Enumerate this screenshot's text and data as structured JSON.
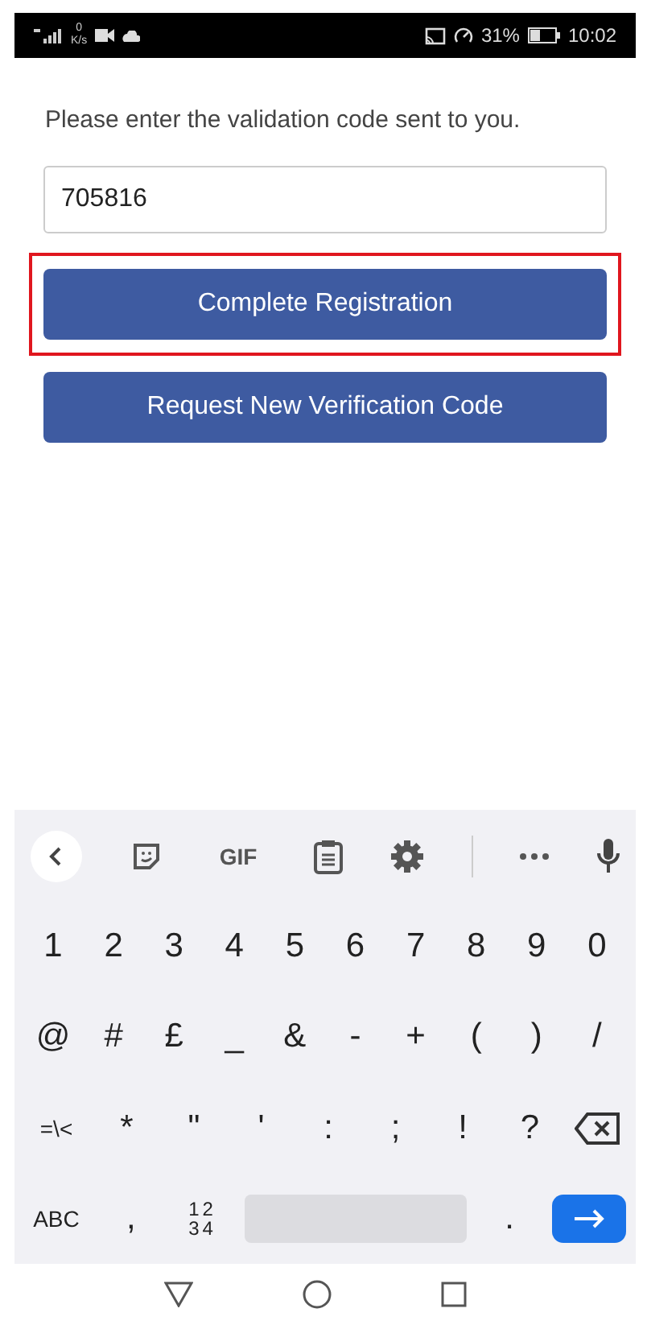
{
  "status_bar": {
    "speed_value": "0",
    "speed_unit": "K/s",
    "battery_percent": "31%",
    "time": "10:02"
  },
  "form": {
    "prompt": "Please enter the validation code sent to you.",
    "code_field": {
      "value": "705816"
    },
    "buttons": [
      {
        "label": "Complete Registration",
        "highlighted": true
      },
      {
        "label": "Request New Verification Code",
        "highlighted": false
      }
    ]
  },
  "keyboard": {
    "toolbar": [
      {
        "kind": "back"
      },
      {
        "kind": "sticker"
      },
      {
        "kind": "text",
        "label": "GIF"
      },
      {
        "kind": "clipboard"
      },
      {
        "kind": "settings"
      },
      {
        "kind": "divider"
      },
      {
        "kind": "more"
      },
      {
        "kind": "mic"
      }
    ],
    "rows": [
      [
        {
          "kind": "char",
          "label": "1"
        },
        {
          "kind": "char",
          "label": "2"
        },
        {
          "kind": "char",
          "label": "3"
        },
        {
          "kind": "char",
          "label": "4"
        },
        {
          "kind": "char",
          "label": "5"
        },
        {
          "kind": "char",
          "label": "6"
        },
        {
          "kind": "char",
          "label": "7"
        },
        {
          "kind": "char",
          "label": "8"
        },
        {
          "kind": "char",
          "label": "9"
        },
        {
          "kind": "char",
          "label": "0"
        }
      ],
      [
        {
          "kind": "char",
          "label": "@"
        },
        {
          "kind": "char",
          "label": "#"
        },
        {
          "kind": "char",
          "label": "£"
        },
        {
          "kind": "char",
          "label": "_"
        },
        {
          "kind": "char",
          "label": "&"
        },
        {
          "kind": "char",
          "label": "-"
        },
        {
          "kind": "char",
          "label": "+"
        },
        {
          "kind": "char",
          "label": "("
        },
        {
          "kind": "char",
          "label": ")"
        },
        {
          "kind": "char",
          "label": "/"
        }
      ],
      [
        {
          "kind": "small",
          "label": "=\\<"
        },
        {
          "kind": "char",
          "label": "*"
        },
        {
          "kind": "char",
          "label": "\""
        },
        {
          "kind": "char",
          "label": "'"
        },
        {
          "kind": "char",
          "label": ":"
        },
        {
          "kind": "char",
          "label": ";"
        },
        {
          "kind": "char",
          "label": "!"
        },
        {
          "kind": "char",
          "label": "?"
        },
        {
          "kind": "backspace"
        }
      ],
      [
        {
          "kind": "small",
          "label": "ABC"
        },
        {
          "kind": "char",
          "label": ","
        },
        {
          "kind": "numbers",
          "lines": [
            "12",
            "34"
          ]
        },
        {
          "kind": "space"
        },
        {
          "kind": "char",
          "label": "."
        },
        {
          "kind": "enter"
        }
      ]
    ]
  },
  "nav_bar": [
    {
      "kind": "back"
    },
    {
      "kind": "home"
    },
    {
      "kind": "recents"
    }
  ]
}
